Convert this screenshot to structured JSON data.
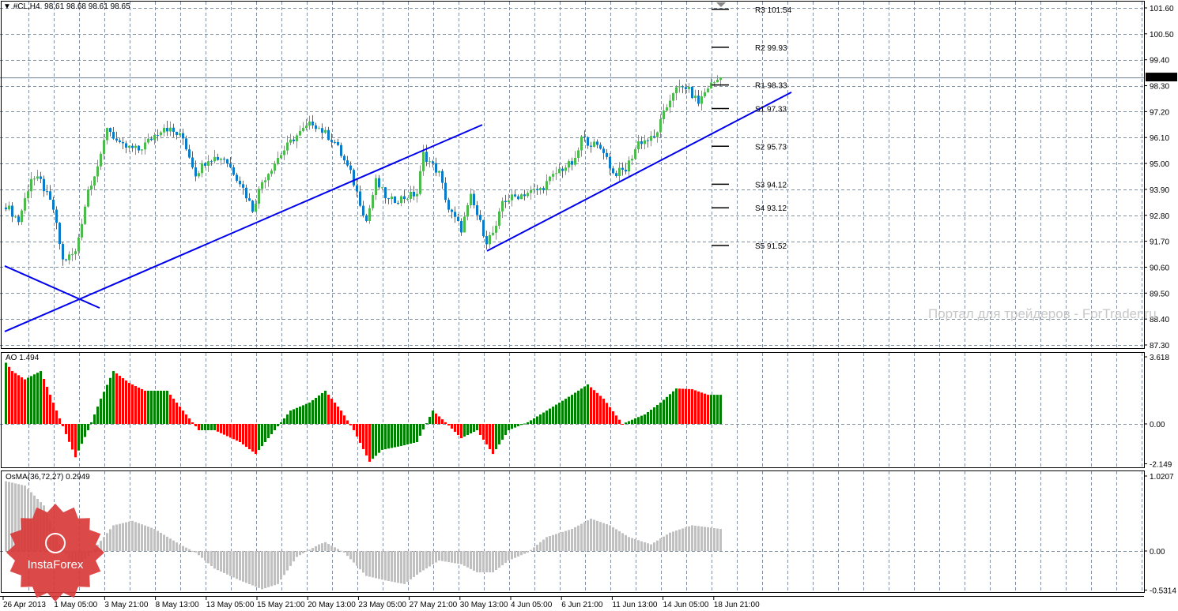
{
  "header": {
    "menu_icon": "triangle-down-icon",
    "symbol": "#CL,H4",
    "ohlc": "98.61 98.68 98.61 98.65"
  },
  "watermark": "Портал для трейдеров - ForTrader.ru",
  "logo": {
    "text": "InstaForex"
  },
  "colors": {
    "bull": "#4cbb4c",
    "bear": "#0a7bc8",
    "trendline": "#0000ee",
    "ao_up": "#008000",
    "ao_down": "#ff0000",
    "osma": "#c0c0c0",
    "grid": "#8090a0"
  },
  "chart_data": [
    {
      "type": "candlestick",
      "title": "#CL,H4",
      "ylim": [
        87.3,
        101.6
      ],
      "y_ticks": [
        "101.60",
        "100.50",
        "99.40",
        "98.30",
        "97.20",
        "96.10",
        "95.00",
        "93.90",
        "92.80",
        "91.70",
        "90.60",
        "89.50",
        "88.40",
        "87.30"
      ],
      "x_ticks": [
        "26 Apr 2013",
        "1 May 05:00",
        "3 May 21:00",
        "8 May 13:00",
        "13 May 05:00",
        "15 May 21:00",
        "20 May 13:00",
        "23 May 05:00",
        "27 May 21:00",
        "30 May 13:00",
        "4 Jun 05:00",
        "6 Jun 21:00",
        "11 Jun 13:00",
        "14 Jun 05:00",
        "18 Jun 21:00"
      ],
      "bar_count": 227,
      "close_path": [
        [
          0,
          93.23
        ],
        [
          4,
          92.56
        ],
        [
          8,
          94.4
        ],
        [
          11,
          94.23
        ],
        [
          15,
          93.06
        ],
        [
          18,
          90.88
        ],
        [
          22,
          91.22
        ],
        [
          26,
          93.9
        ],
        [
          30,
          95.24
        ],
        [
          32,
          96.58
        ],
        [
          36,
          95.74
        ],
        [
          42,
          95.57
        ],
        [
          50,
          96.58
        ],
        [
          56,
          96.07
        ],
        [
          60,
          94.57
        ],
        [
          64,
          95.24
        ],
        [
          69,
          95.24
        ],
        [
          74,
          94.23
        ],
        [
          78,
          93.06
        ],
        [
          81,
          94.23
        ],
        [
          86,
          95.24
        ],
        [
          91,
          96.07
        ],
        [
          97,
          96.74
        ],
        [
          104,
          95.91
        ],
        [
          109,
          94.57
        ],
        [
          114,
          92.56
        ],
        [
          117,
          94.23
        ],
        [
          121,
          93.4
        ],
        [
          126,
          93.56
        ],
        [
          130,
          93.73
        ],
        [
          132,
          95.4
        ],
        [
          137,
          94.57
        ],
        [
          140,
          93.06
        ],
        [
          144,
          92.22
        ],
        [
          147,
          93.56
        ],
        [
          152,
          91.72
        ],
        [
          155,
          92.22
        ],
        [
          157,
          93.4
        ],
        [
          164,
          93.73
        ],
        [
          169,
          93.9
        ],
        [
          175,
          94.73
        ],
        [
          180,
          95.07
        ],
        [
          182,
          96.07
        ],
        [
          189,
          95.57
        ],
        [
          192,
          94.57
        ],
        [
          196,
          94.73
        ],
        [
          200,
          95.91
        ],
        [
          205,
          96.07
        ],
        [
          207,
          96.74
        ],
        [
          211,
          98.08
        ],
        [
          215,
          98.25
        ],
        [
          219,
          97.58
        ],
        [
          222,
          98.25
        ],
        [
          226,
          98.65
        ]
      ],
      "current_price": "98.65",
      "trendlines": [
        {
          "from": [
            0,
            87.87
          ],
          "to": [
            151,
            96.64
          ]
        },
        {
          "from": [
            0,
            90.65
          ],
          "to": [
            30,
            88.87
          ]
        },
        {
          "from": [
            152.5,
            91.29
          ],
          "to": [
            248.75,
            98.02
          ]
        }
      ],
      "pivots": [
        {
          "label": "R3",
          "value": "101.54"
        },
        {
          "label": "R2",
          "value": "99.93"
        },
        {
          "label": "R1",
          "value": "98.33"
        },
        {
          "label": "S1",
          "value": "97.33"
        },
        {
          "label": "S2",
          "value": "95.73"
        },
        {
          "label": "S3",
          "value": "94.12"
        },
        {
          "label": "S4",
          "value": "93.12"
        },
        {
          "label": "S5",
          "value": "91.52"
        }
      ]
    },
    {
      "type": "bar",
      "title": "AO 1.494",
      "ylim": [
        -2.149,
        3.618
      ],
      "y_ticks": [
        "3.618",
        "0.00",
        "-2.149"
      ],
      "value_path": [
        [
          0,
          3.3
        ],
        [
          2,
          2.85
        ],
        [
          6,
          2.4
        ],
        [
          11,
          2.85
        ],
        [
          15,
          1.15
        ],
        [
          19,
          -0.55
        ],
        [
          22,
          -1.8
        ],
        [
          26,
          -0.34
        ],
        [
          30,
          1.36
        ],
        [
          34,
          2.85
        ],
        [
          39,
          2.21
        ],
        [
          44,
          1.79
        ],
        [
          51,
          1.79
        ],
        [
          56,
          0.72
        ],
        [
          61,
          -0.34
        ],
        [
          66,
          -0.34
        ],
        [
          74,
          -0.98
        ],
        [
          79,
          -1.62
        ],
        [
          85,
          -0.34
        ],
        [
          90,
          0.72
        ],
        [
          96,
          1.15
        ],
        [
          101,
          1.79
        ],
        [
          106,
          0.72
        ],
        [
          110,
          -0.34
        ],
        [
          115,
          -2.04
        ],
        [
          119,
          -1.4
        ],
        [
          125,
          -1.19
        ],
        [
          130,
          -0.98
        ],
        [
          135,
          0.72
        ],
        [
          139,
          0.09
        ],
        [
          144,
          -0.77
        ],
        [
          149,
          -0.34
        ],
        [
          154,
          -1.62
        ],
        [
          159,
          -0.34
        ],
        [
          165,
          0.09
        ],
        [
          171,
          0.72
        ],
        [
          179,
          1.57
        ],
        [
          184,
          2.13
        ],
        [
          189,
          1.36
        ],
        [
          195,
          0
        ],
        [
          199,
          0.3
        ],
        [
          202,
          0.51
        ],
        [
          207,
          1.15
        ],
        [
          212,
          1.91
        ],
        [
          217,
          1.87
        ],
        [
          222,
          1.57
        ],
        [
          226,
          1.57
        ]
      ]
    },
    {
      "type": "bar",
      "title": "OsMA(36,72,27) 0.2949",
      "ylim": [
        -0.5314,
        1.0207
      ],
      "y_ticks": [
        "1.0207",
        "0.00",
        "-0.5314"
      ],
      "value_path": [
        [
          0,
          0.95
        ],
        [
          6,
          0.89
        ],
        [
          12,
          0.62
        ],
        [
          17,
          0.09
        ],
        [
          22,
          -0.24
        ],
        [
          27,
          -0.02
        ],
        [
          34,
          0.35
        ],
        [
          40,
          0.41
        ],
        [
          47,
          0.3
        ],
        [
          55,
          0.09
        ],
        [
          60,
          -0.02
        ],
        [
          66,
          -0.24
        ],
        [
          74,
          -0.4
        ],
        [
          81,
          -0.52
        ],
        [
          86,
          -0.45
        ],
        [
          92,
          -0.08
        ],
        [
          99,
          0.09
        ],
        [
          101,
          0.12
        ],
        [
          107,
          -0.02
        ],
        [
          114,
          -0.34
        ],
        [
          120,
          -0.4
        ],
        [
          126,
          -0.45
        ],
        [
          131,
          -0.29
        ],
        [
          137,
          -0.13
        ],
        [
          144,
          -0.18
        ],
        [
          149,
          -0.29
        ],
        [
          154,
          -0.29
        ],
        [
          159,
          -0.13
        ],
        [
          165,
          -0.02
        ],
        [
          171,
          0.19
        ],
        [
          179,
          0.3
        ],
        [
          185,
          0.44
        ],
        [
          191,
          0.35
        ],
        [
          197,
          0.19
        ],
        [
          204,
          0.09
        ],
        [
          210,
          0.25
        ],
        [
          217,
          0.35
        ],
        [
          226,
          0.3
        ]
      ]
    }
  ]
}
